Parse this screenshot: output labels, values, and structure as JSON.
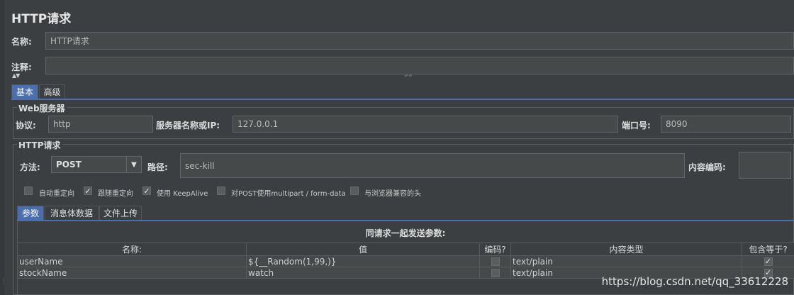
{
  "header": {
    "title": "HTTP请求"
  },
  "name_row": {
    "label": "名称:",
    "value": "HTTP请求"
  },
  "comment_row": {
    "label": "注释:",
    "value": ""
  },
  "collapse_glyph": "▲▼",
  "resize_glyph": "⩫⩫",
  "top_tabs": [
    {
      "label": "基本"
    },
    {
      "label": "高级"
    }
  ],
  "web_server": {
    "title": "Web服务器",
    "protocol_label": "协议:",
    "protocol_value": "http",
    "server_label": "服务器名称或IP:",
    "server_value": "127.0.0.1",
    "port_label": "端口号:",
    "port_value": "8090"
  },
  "http_request": {
    "title": "HTTP请求",
    "method_label": "方法:",
    "method_value": "POST",
    "path_label": "路径:",
    "path_value": "sec-kill",
    "encoding_label": "内容编码:",
    "encoding_value": ""
  },
  "options": [
    {
      "label": "自动重定向",
      "checked": false
    },
    {
      "label": "跟随重定向",
      "checked": true
    },
    {
      "label": "使用 KeepAlive",
      "checked": true
    },
    {
      "label": "对POST使用multipart / form-data",
      "checked": false
    },
    {
      "label": "与浏览器兼容的头",
      "checked": false
    }
  ],
  "sub_tabs": [
    {
      "label": "参数"
    },
    {
      "label": "消息体数据"
    },
    {
      "label": "文件上传"
    }
  ],
  "params": {
    "caption": "同请求一起发送参数:",
    "columns": [
      "名称:",
      "值",
      "编码?",
      "内容类型",
      "包含等于?"
    ],
    "rows": [
      {
        "name": "userName",
        "value": "${__Random(1,99,)}",
        "encode": false,
        "content_type": "text/plain",
        "include_equals": true
      },
      {
        "name": "stockName",
        "value": "watch",
        "encode": false,
        "content_type": "text/plain",
        "include_equals": true
      }
    ]
  },
  "watermark": "https://blog.csdn.net/qq_33612228",
  "colors": {
    "background": "#3c3f41",
    "field": "#45494a",
    "selected_tab": "#4b6eaf"
  }
}
